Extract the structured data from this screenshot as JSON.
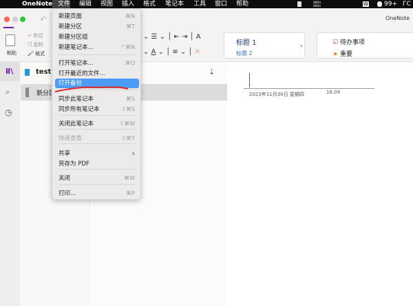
{
  "menubar": {
    "app": "OneNote",
    "items": [
      "文件",
      "编辑",
      "视图",
      "插入",
      "格式",
      "笔记本",
      "工具",
      "窗口",
      "帮助"
    ],
    "net_up": "0KB/s",
    "net_down": "0KB/s",
    "badge": "99+",
    "extra": "ГС"
  },
  "window": {
    "title": "OneNote"
  },
  "ribbon": {
    "paste": "粘贴",
    "cut": "剪切",
    "copy": "复制",
    "format": "格式",
    "heading1": "标题 1",
    "heading2": "标题 2",
    "todo": "待办事项",
    "important": "重要"
  },
  "notebook": {
    "name": "test2",
    "section": "新分区"
  },
  "page": {
    "date": "2023年11月30日 星期四",
    "time": "16:09"
  },
  "file_menu": {
    "items": [
      {
        "label": "新建页面",
        "shortcut": "⌘N"
      },
      {
        "label": "新建分区",
        "shortcut": "⌘T"
      },
      {
        "label": "新建分区组",
        "shortcut": ""
      },
      {
        "label": "新建笔记本...",
        "shortcut": "^⌘N"
      },
      {
        "label": "打开笔记本...",
        "shortcut": "⌘O"
      },
      {
        "label": "打开最近的文件...",
        "shortcut": ""
      },
      {
        "label": "打开备份",
        "shortcut": ""
      },
      {
        "label": "同步此笔记本",
        "shortcut": "⌘S"
      },
      {
        "label": "同步所有笔记本",
        "shortcut": "⇧⌘S"
      },
      {
        "label": "关闭此笔记本",
        "shortcut": "⇧⌘W"
      },
      {
        "label": "快速查看",
        "shortcut": "⇧⌘Y"
      },
      {
        "label": "共享",
        "shortcut": "›"
      },
      {
        "label": "另存为 PDF",
        "shortcut": ""
      },
      {
        "label": "关闭",
        "shortcut": "⌘W"
      },
      {
        "label": "打印...",
        "shortcut": "⌘P"
      }
    ]
  },
  "colors": {
    "accent": "#7719aa",
    "highlight": "#4c9bf7",
    "annotation": "#e8231e"
  }
}
